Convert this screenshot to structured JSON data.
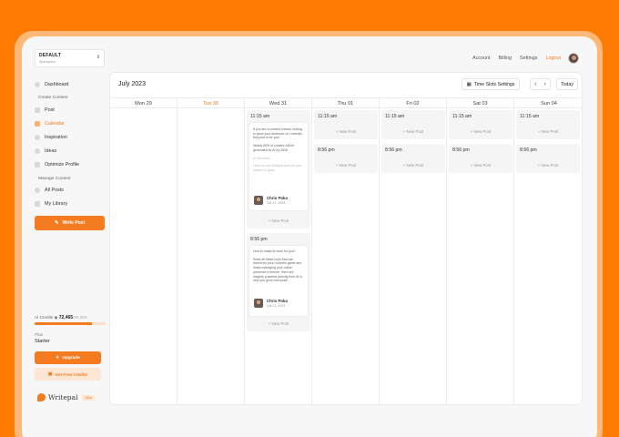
{
  "workspace": {
    "name": "DEFAULT",
    "subtitle": "Workspace"
  },
  "sidebar": {
    "items": [
      {
        "label": "Dashboard",
        "icon": "dashboard-icon"
      },
      {
        "label": "Post",
        "icon": "post-icon"
      },
      {
        "label": "Calendar",
        "icon": "calendar-icon",
        "active": true
      },
      {
        "label": "Inspiration",
        "icon": "inspiration-icon"
      },
      {
        "label": "Ideas",
        "icon": "lightbulb-icon"
      },
      {
        "label": "Optimize Profile",
        "icon": "optimize-icon"
      },
      {
        "label": "All Posts",
        "icon": "all-posts-icon"
      },
      {
        "label": "My Library",
        "icon": "library-icon"
      }
    ],
    "section_create": "Create Content",
    "section_manage": "Manage Content",
    "write_label": "Write Post"
  },
  "credits": {
    "label": "AI Credits",
    "value": "72,465",
    "total": "/90,000",
    "fraction": 0.805,
    "plan_label": "Plan",
    "plan_value": "Starter",
    "upgrade_label": "Upgrade",
    "free_label": "Get Free Credits"
  },
  "brand": {
    "name": "Writepal",
    "beta": "Beta",
    "accent": "#F47B20"
  },
  "topnav": {
    "account": "Account",
    "billing": "Billing",
    "settings": "Settings",
    "logout": "Logout"
  },
  "calendar": {
    "title": "July 2023",
    "time_slots_label": "Time Slots Settings",
    "today_label": "Today",
    "prev": "‹",
    "next": "›",
    "days": [
      "Mon 29",
      "Tue 30",
      "Wed 31",
      "Thu 01",
      "Fri 02",
      "Sat 03",
      "Sun 04"
    ],
    "slot_am": "11:15 am",
    "slot_pm": "8:56 pm",
    "new_post": "+ New Post",
    "post1": {
      "p1": "If you are a content creator looking to grow your audience on LinkedIn, this post is for you!",
      "p2": "Nearly 80% of content will be generated by AI by 2026.",
      "p3": "In this week...",
      "p4": "Learn to use Writepal and set your system to grow.",
      "author": "Chris Poka",
      "date": "Sat 21, 2024"
    },
    "post2": {
      "p1": "How to make AI work for you?",
      "p2": "Read all these tools that can transform your LinkedIn game and make managing your online presence a breeze. Here are insights powered directly from AI to help you grow and scale.",
      "author": "Chris Poka",
      "date": "Sat 21, 2024"
    }
  }
}
